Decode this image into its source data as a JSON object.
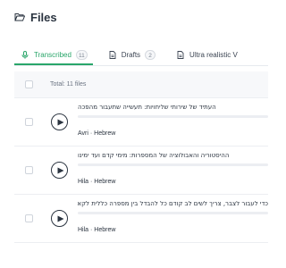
{
  "header": {
    "title": "Files",
    "icon": "folder-open-icon"
  },
  "tabs": [
    {
      "label": "Transcribed",
      "count": "11",
      "icon": "microphone-icon",
      "active": true
    },
    {
      "label": "Drafts",
      "count": "2",
      "icon": "document-icon",
      "active": false
    },
    {
      "label": "Ultra realistic V",
      "icon": "document-icon",
      "active": false
    }
  ],
  "list": {
    "total_label": "Total: 11 files",
    "rows": [
      {
        "title": "העתיד של שירותי שליחויות: תעשייה שתעבור מהפכה",
        "meta": "Avri · Hebrew"
      },
      {
        "title": "ההיסטוריה והאבולוציה של המספרות: מימי קדם ועד ימינו",
        "meta": "Hila · Hebrew"
      },
      {
        "title": "כדי לעבור לצבר, צריך לשים לב קודם כל להבדל בין מספרה כללית לקאפית המספרת",
        "meta": "Hila · Hebrew"
      }
    ]
  },
  "colors": {
    "accent": "#2aa66a",
    "text": "#2b3440",
    "muted": "#7b8491",
    "header_bg": "#f7f8fa"
  }
}
